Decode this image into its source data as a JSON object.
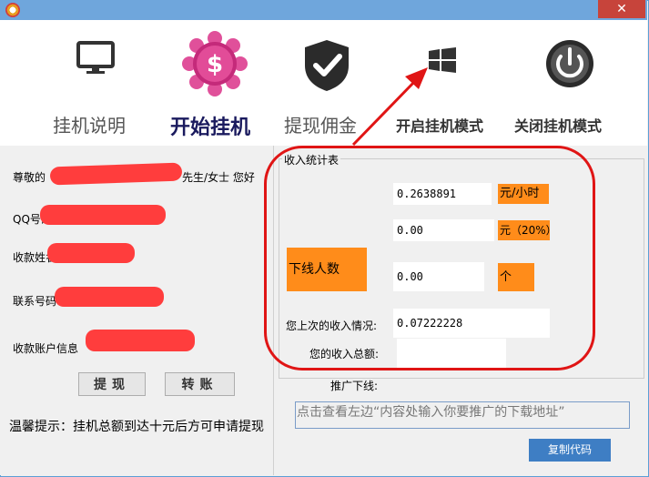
{
  "window": {
    "close_glyph": "✕"
  },
  "nav": {
    "items": [
      {
        "label": "挂机说明",
        "icon": "monitor-icon"
      },
      {
        "label": "开始挂机",
        "icon": "dollar-flower-icon"
      },
      {
        "label": "提现佣金",
        "icon": "shield-check-icon"
      },
      {
        "label": "开启挂机模式",
        "icon": "windows-icon"
      },
      {
        "label": "关闭挂机模式",
        "icon": "power-icon"
      }
    ]
  },
  "left": {
    "greeting_prefix": "尊敬的",
    "greeting_suffix": "先生/女士  您好",
    "qq_label": "QQ号码",
    "name_label": "收款姓名",
    "phone_label": "联系号码",
    "account_label": "收款账户信息",
    "withdraw_button": "提现",
    "transfer_button": "转账",
    "hint": "温馨提示：挂机总额到达十元后方可申请提现"
  },
  "stats": {
    "group_title": "收入统计表",
    "rate_value": "0.2638891",
    "rate_unit": "元/小时",
    "share_value": "0.00",
    "share_unit": "元（20%）",
    "downline_label": "下线人数",
    "downline_value": "0.00",
    "downline_unit": "个",
    "last_income_label": "您上次的收入情况:",
    "last_income_value": "0.07222228",
    "total_income_label": "您的收入总额:",
    "total_income_value": "",
    "promote_label": "推广下线:",
    "promote_placeholder": "点击查看左边“内容处输入你要推广的下载地址”",
    "copy_button": "复制代码"
  },
  "colors": {
    "accent": "#ff8c1a",
    "annotation": "#e01515",
    "titlebar": "#6fa6dc"
  }
}
